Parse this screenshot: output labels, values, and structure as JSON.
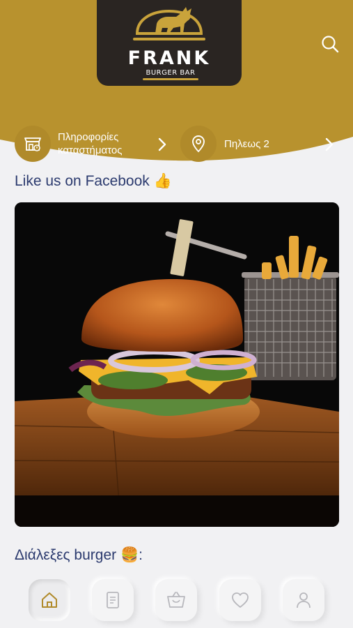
{
  "brand": {
    "name": "FRANK",
    "subtitle": "BURGER BAR",
    "color_gold": "#b8922e",
    "color_dark": "#2a2522"
  },
  "header": {
    "search_icon": "search-icon"
  },
  "info": {
    "store_info_label": "Πληροφορίες καταστήματος",
    "address_label": "Πηλεως 2"
  },
  "facebook": {
    "title": "Like us on Facebook 👍"
  },
  "choose": {
    "title": "Διάλεξες burger 🍔:"
  },
  "nav": {
    "items": [
      {
        "icon": "home-icon",
        "active": true
      },
      {
        "icon": "menu-document-icon",
        "active": false
      },
      {
        "icon": "shopping-bag-icon",
        "active": false
      },
      {
        "icon": "heart-icon",
        "active": false
      },
      {
        "icon": "user-icon",
        "active": false
      }
    ]
  }
}
